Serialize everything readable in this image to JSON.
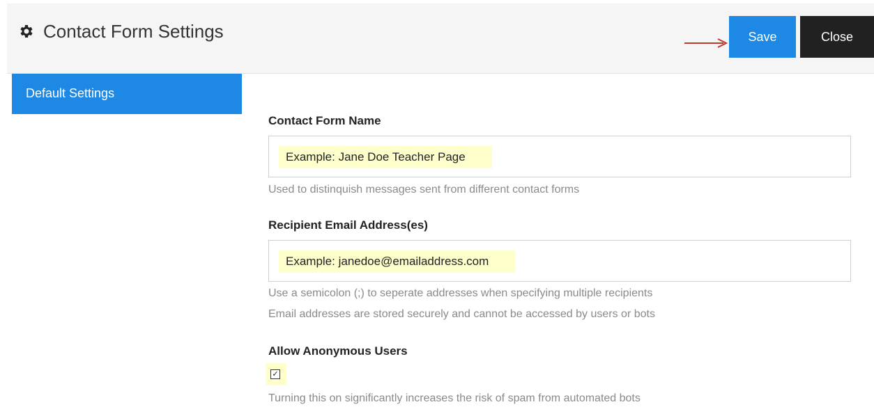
{
  "header": {
    "title": "Contact Form Settings",
    "save_label": "Save",
    "close_label": "Close"
  },
  "sidebar": {
    "items": [
      {
        "label": "Default Settings",
        "active": true
      }
    ]
  },
  "form": {
    "name": {
      "label": "Contact Form Name",
      "value": "Example:  Jane Doe Teacher Page",
      "help": "Used to distinquish messages sent from different contact forms"
    },
    "email": {
      "label": "Recipient Email Address(es)",
      "value": "Example:  janedoe@emailaddress.com",
      "help1": "Use a semicolon (;) to seperate addresses when specifying multiple recipients",
      "help2": "Email addresses are stored securely and cannot be accessed by users or bots"
    },
    "anonymous": {
      "label": "Allow Anonymous Users",
      "checked": true,
      "help": "Turning this on significantly increases the risk of spam from automated bots"
    }
  },
  "colors": {
    "accent": "#1e88e5",
    "close_button": "#212121",
    "highlight": "#ffffcc",
    "arrow": "#c0392b"
  }
}
